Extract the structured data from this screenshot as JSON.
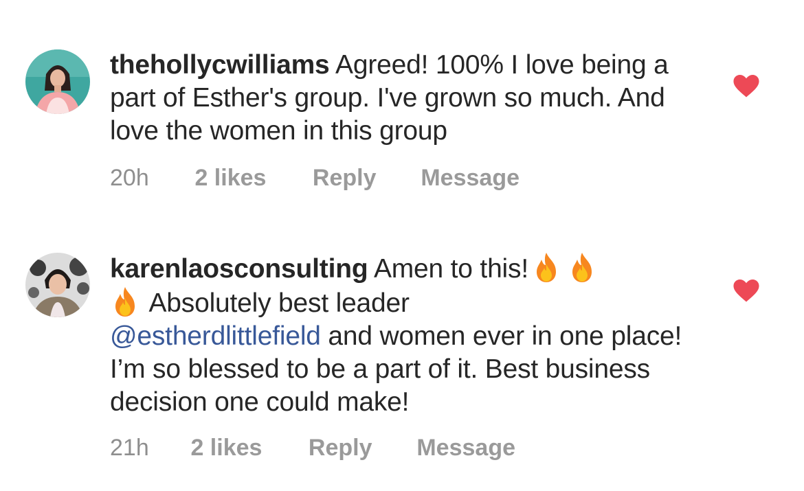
{
  "comments": [
    {
      "username": "thehollycwilliams",
      "text": "Agreed! 100% I love being a part of Esther's group. I've grown so much. And love the women in this group",
      "time": "20h",
      "likes": "2 likes",
      "reply_label": "Reply",
      "message_label": "Message",
      "liked": true
    },
    {
      "username": "karenlaosconsulting",
      "text_before_emoji": "Amen to this!",
      "text_after_emoji": "Absolutely best leader",
      "mention": "@estherdlittlefield",
      "text_after_mention": "and women ever in one place! I’m so blessed to be a part of it. Best business decision one could make!",
      "emojis": [
        "fire-emoji",
        "fire-emoji",
        "fire-emoji"
      ],
      "time": "21h",
      "likes": "2 likes",
      "reply_label": "Reply",
      "message_label": "Message",
      "liked": true
    }
  ],
  "colors": {
    "heart": "#ed4956",
    "mention": "#385898",
    "meta": "#8e8e8e",
    "text": "#262626"
  }
}
